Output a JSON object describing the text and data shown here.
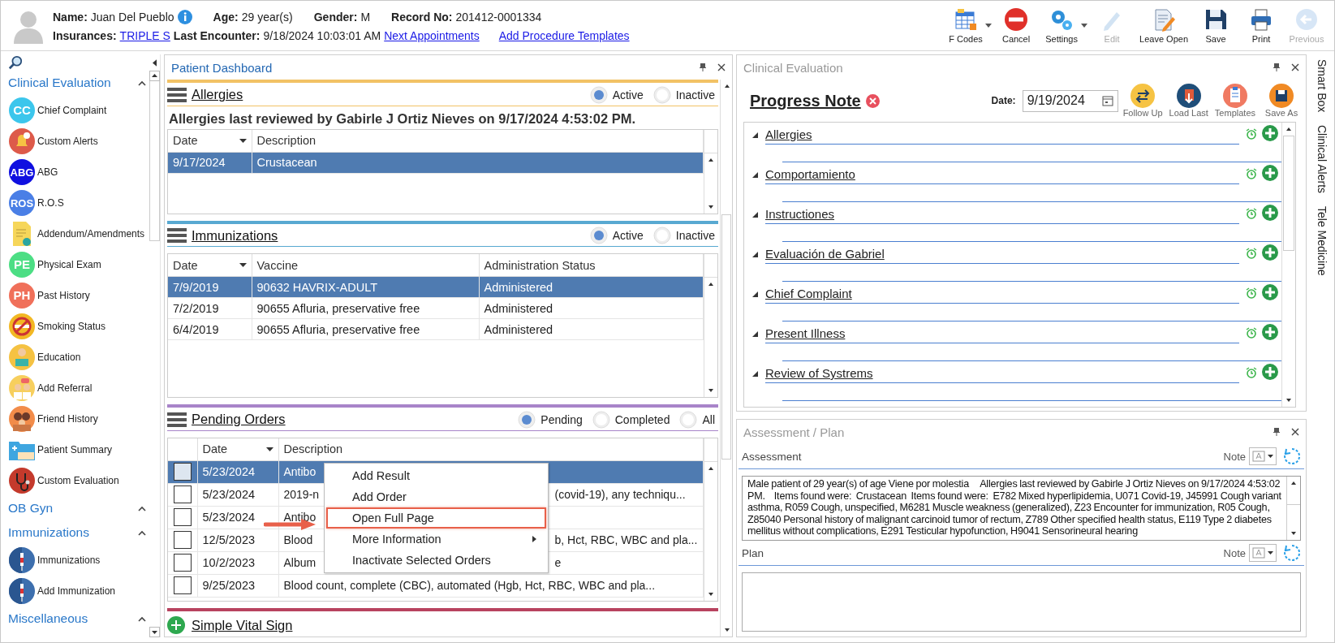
{
  "header": {
    "name_label": "Name:",
    "name": "Juan Del Pueblo",
    "age_label": "Age:",
    "age": "29 year(s)",
    "gender_label": "Gender:",
    "gender": "M",
    "record_label": "Record No:",
    "record": "201412-0001334",
    "insurances_label": "Insurances:",
    "insurance": "TRIPLE S",
    "last_encounter_label": "Last Encounter:",
    "last_encounter": "9/18/2024 10:03:01 AM",
    "links": [
      "Next Appointments",
      "Add Procedure Templates"
    ]
  },
  "toolbar": [
    {
      "label": "F Codes",
      "kind": "fcodes",
      "dropdown": true,
      "disabled": false
    },
    {
      "label": "Cancel",
      "kind": "cancel",
      "dropdown": false,
      "disabled": false
    },
    {
      "label": "Settings",
      "kind": "gears",
      "dropdown": true,
      "disabled": false
    },
    {
      "label": "Edit",
      "kind": "pencil",
      "dropdown": false,
      "disabled": true
    },
    {
      "label": "Leave Open",
      "kind": "docpen",
      "dropdown": false,
      "disabled": false
    },
    {
      "label": "Save",
      "kind": "floppy",
      "dropdown": false,
      "disabled": false
    },
    {
      "label": "Print",
      "kind": "printer",
      "dropdown": false,
      "disabled": false
    },
    {
      "label": "Previous",
      "kind": "back",
      "dropdown": false,
      "disabled": true
    }
  ],
  "sidebar": {
    "groups": [
      {
        "title": "Clinical Evaluation",
        "items": [
          {
            "label": "Chief Complaint",
            "badge": "CC",
            "color": "#3cc6ec"
          },
          {
            "label": "Custom Alerts",
            "kind": "bell",
            "color": "#dd5a4a"
          },
          {
            "label": "ABG",
            "badge": "ABG",
            "color": "#1010e0"
          },
          {
            "label": "R.O.S",
            "badge": "ROS",
            "color": "#4a7fe6"
          },
          {
            "label": "Addendum/Amendments",
            "kind": "doc",
            "color": "#f6d65a"
          },
          {
            "label": "Physical Exam",
            "badge": "PE",
            "color": "#4cde84"
          },
          {
            "label": "Past History",
            "badge": "PH",
            "color": "#f0705a"
          },
          {
            "label": "Smoking Status",
            "kind": "nosmoking",
            "color": "#f2b823"
          },
          {
            "label": "Education",
            "kind": "person",
            "color": "#f5c242"
          },
          {
            "label": "Add Referral",
            "kind": "people",
            "color": "#f7cf5e"
          },
          {
            "label": "Friend History",
            "kind": "family",
            "color": "#f28c4a"
          },
          {
            "label": "Patient Summary",
            "kind": "folder",
            "color": "#3fa6e0"
          },
          {
            "label": "Custom Evaluation",
            "kind": "stethoscope",
            "color": "#c43a2c"
          }
        ]
      },
      {
        "title": "OB Gyn"
      },
      {
        "title": "Immunizations",
        "items": [
          {
            "label": "Immunizations",
            "kind": "syringe",
            "color": "#3d6fae"
          },
          {
            "label": "Add Immunization",
            "kind": "syringe",
            "color": "#3d6fae"
          }
        ]
      },
      {
        "title": "Miscellaneous"
      }
    ]
  },
  "dashboard": {
    "title": "Patient Dashboard",
    "sections": [
      {
        "title": "Allergies",
        "color": "#f2c265",
        "filters": [
          {
            "label": "Active",
            "selected": true
          },
          {
            "label": "Inactive",
            "selected": false
          }
        ],
        "note": "Allergies last reviewed by Gabirle J Ortiz Nieves on 9/17/2024 4:53:02 PM.",
        "columns": [
          "Date",
          "Description"
        ],
        "rows": [
          {
            "cells": [
              "9/17/2024",
              "Crustacean"
            ],
            "selected": true
          }
        ]
      },
      {
        "title": "Immunizations",
        "color": "#58a9d1",
        "filters": [
          {
            "label": "Active",
            "selected": true
          },
          {
            "label": "Inactive",
            "selected": false
          }
        ],
        "columns": [
          "Date",
          "Vaccine",
          "Administration Status"
        ],
        "rows": [
          {
            "cells": [
              "7/9/2019",
              "90632 HAVRIX-ADULT",
              "Administered"
            ],
            "selected": true
          },
          {
            "cells": [
              "7/2/2019",
              "90655 Afluria, preservative free",
              "Administered"
            ],
            "selected": false
          },
          {
            "cells": [
              "6/4/2019",
              "90655 Afluria, preservative free",
              "Administered"
            ],
            "selected": false
          }
        ]
      },
      {
        "title": "Pending Orders",
        "color": "#a884c9",
        "filters": [
          {
            "label": "Pending",
            "selected": true
          },
          {
            "label": "Completed",
            "selected": false
          },
          {
            "label": "All",
            "selected": false
          }
        ],
        "columns": [
          "Date",
          "Description"
        ],
        "rows": [
          {
            "date": "5/23/2024",
            "description": "Antibo",
            "checked": false,
            "selected": true
          },
          {
            "date": "5/23/2024",
            "description": "2019-n",
            "description_end": "(covid-19), any techniqu...",
            "checked": false,
            "selected": false
          },
          {
            "date": "5/23/2024",
            "description": "Antibo",
            "checked": false,
            "selected": false
          },
          {
            "date": "12/5/2023",
            "description": "Blood",
            "description_end": "b, Hct, RBC, WBC and pla...",
            "checked": false,
            "selected": false
          },
          {
            "date": "10/2/2023",
            "description": "Album",
            "description_end": "e",
            "checked": false,
            "selected": false
          },
          {
            "date": "9/25/2023",
            "description": "Blood count, complete (CBC), automated (Hgb, Hct, RBC, WBC and pla...",
            "checked": false,
            "selected": false
          }
        ],
        "context_menu": [
          {
            "label": "Add Result",
            "highlighted": false,
            "submenu": false
          },
          {
            "label": "Add Order",
            "highlighted": false,
            "submenu": false
          },
          {
            "label": "Open Full Page",
            "highlighted": true,
            "submenu": false
          },
          {
            "label": "More Information",
            "highlighted": false,
            "submenu": true
          },
          {
            "label": "Inactivate Selected Orders",
            "highlighted": false,
            "submenu": false
          }
        ]
      },
      {
        "title": "Simple Vital Sign",
        "color": "#b8435f"
      }
    ]
  },
  "clinical": {
    "title": "Clinical Evaluation",
    "note_title": "Progress Note",
    "date_label": "Date:",
    "date": "9/19/2024",
    "actions": [
      {
        "label": "Follow Up",
        "kind": "swap",
        "color": "#f6c343"
      },
      {
        "label": "Load Last",
        "kind": "load",
        "color": "#1f4e79"
      },
      {
        "label": "Templates",
        "kind": "clipboard",
        "color": "#f07a62"
      },
      {
        "label": "Save As",
        "kind": "floppy",
        "color": "#f08a24"
      }
    ],
    "sections": [
      {
        "title": "Allergies",
        "expanded": true
      },
      {
        "title": "Comportamiento",
        "expanded": true
      },
      {
        "title": "Instructiones",
        "expanded": true
      },
      {
        "title": "Evaluación de Gabriel",
        "expanded": true
      },
      {
        "title": "Chief Complaint",
        "expanded": true
      },
      {
        "title": "Present Illness",
        "expanded": true
      },
      {
        "title": "Review of Systrems",
        "expanded": true
      }
    ]
  },
  "assessment_plan": {
    "title": "Assessment / Plan",
    "fields": [
      {
        "label": "Assessment",
        "note_label": "Note",
        "text": "Male patient of 29 year(s) of age Viene por molestia     Allergies last reviewed by Gabirle J Ortiz Nieves on 9/17/2024 4:53:02 PM.    Items found were:  Crustacean  Items found were:  E782 Mixed hyperlipidemia, U071 Covid-19, J45991 Cough variant asthma, R059 Cough, unspecified, M6281 Muscle weakness (generalized), Z23 Encounter for immunization, R05 Cough, Z85040 Personal history of malignant carcinoid tumor of rectum, Z789 Other specified health status, E119 Type 2 diabetes mellitus without complications, E291 Testicular hypofunction, H9041 Sensorineural hearing"
      },
      {
        "label": "Plan",
        "note_label": "Note"
      }
    ]
  },
  "side_tabs": [
    "Smart Box",
    "Clinical Alerts",
    "Tele Medicine"
  ]
}
